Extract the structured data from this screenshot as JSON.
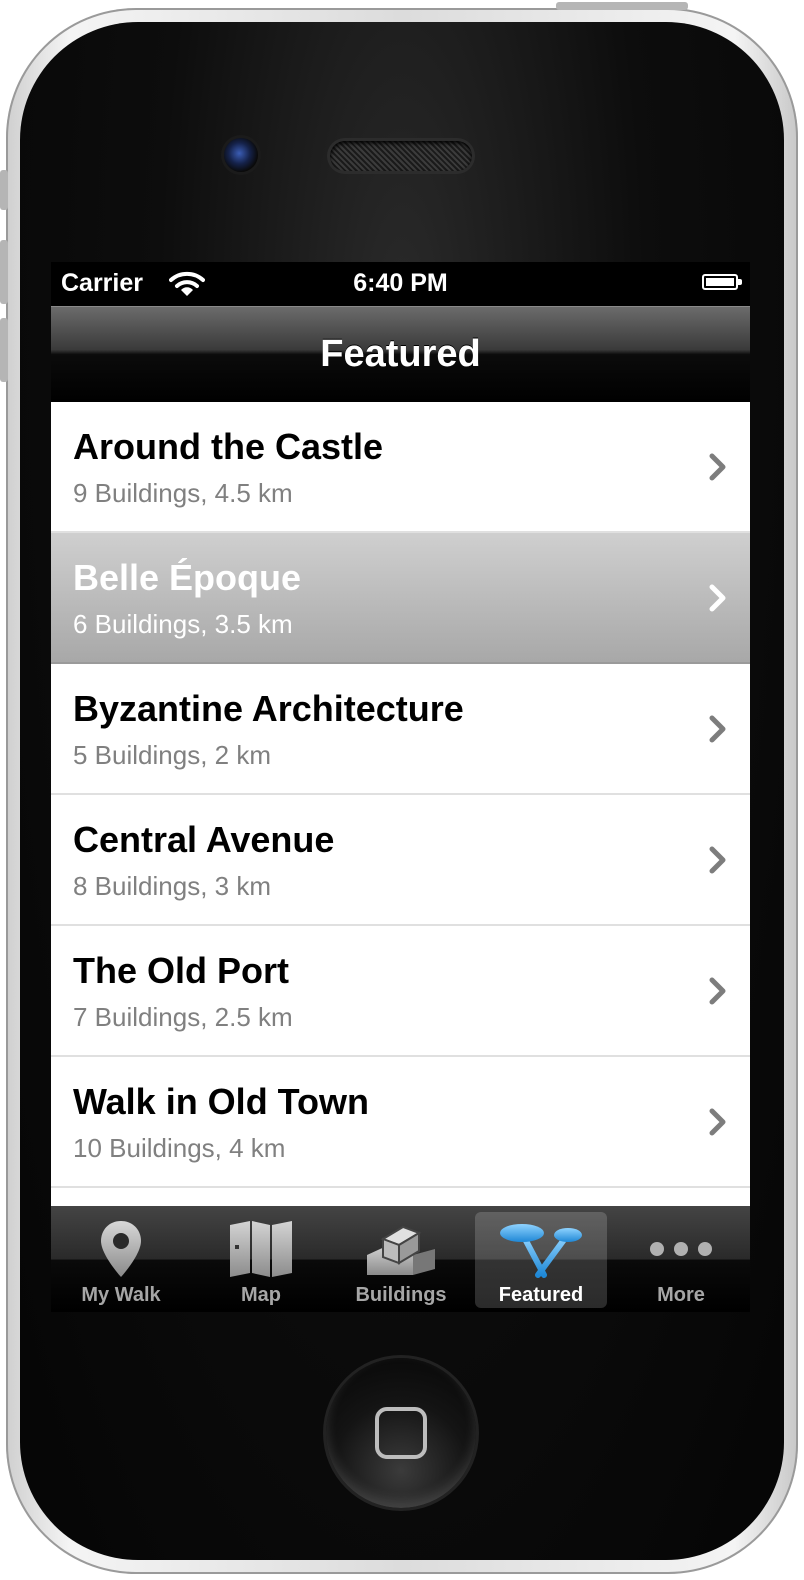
{
  "status_bar": {
    "carrier": "Carrier",
    "time": "6:40 PM",
    "wifi_icon": "wifi-icon",
    "battery_icon": "battery-icon"
  },
  "nav_bar": {
    "title": "Featured"
  },
  "walks": [
    {
      "title": "Around the Castle",
      "subtitle": "9 Buildings, 4.5 km",
      "selected": false
    },
    {
      "title": "Belle Époque",
      "subtitle": "6 Buildings, 3.5 km",
      "selected": true
    },
    {
      "title": "Byzantine Architecture",
      "subtitle": "5 Buildings, 2 km",
      "selected": false
    },
    {
      "title": "Central Avenue",
      "subtitle": "8 Buildings, 3 km",
      "selected": false
    },
    {
      "title": "The Old Port",
      "subtitle": "7 Buildings, 2.5 km",
      "selected": false
    },
    {
      "title": "Walk in Old Town",
      "subtitle": "10 Buildings, 4 km",
      "selected": false
    }
  ],
  "tab_bar": {
    "active": "Featured",
    "tabs": [
      {
        "label": "My Walk",
        "icon": "map-pin-icon"
      },
      {
        "label": "Map",
        "icon": "folded-map-icon"
      },
      {
        "label": "Buildings",
        "icon": "buildings-icon"
      },
      {
        "label": "Featured",
        "icon": "featured-pins-icon"
      },
      {
        "label": "More",
        "icon": "more-dots-icon"
      }
    ]
  },
  "colors": {
    "selected_row": "#b0b0b0",
    "subtitle": "#808080",
    "featured_accent": "#3aa7ea"
  }
}
